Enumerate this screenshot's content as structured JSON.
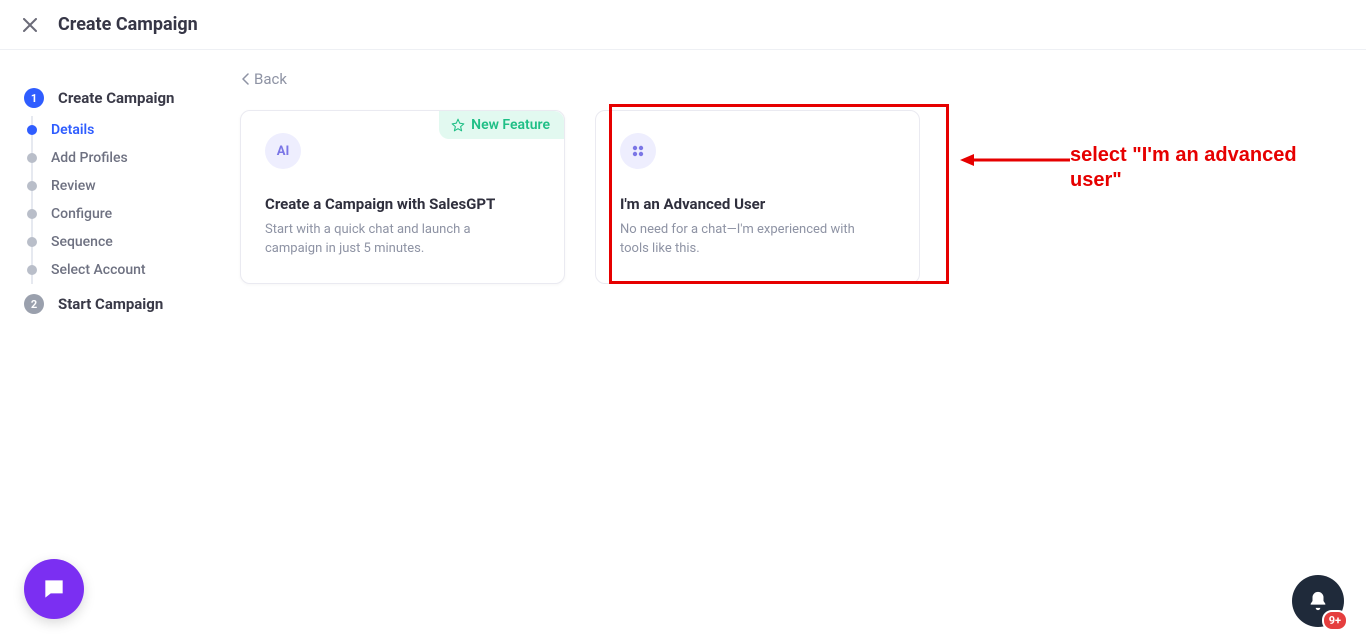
{
  "header": {
    "title": "Create Campaign"
  },
  "steps": [
    {
      "num": "1",
      "label": "Create Campaign",
      "active": true,
      "substeps": [
        {
          "label": "Details",
          "current": true
        },
        {
          "label": "Add Profiles",
          "current": false
        },
        {
          "label": "Review",
          "current": false
        },
        {
          "label": "Configure",
          "current": false
        },
        {
          "label": "Sequence",
          "current": false
        },
        {
          "label": "Select Account",
          "current": false
        }
      ]
    },
    {
      "num": "2",
      "label": "Start Campaign",
      "active": false,
      "substeps": []
    }
  ],
  "main": {
    "back": "Back",
    "cards": {
      "salesgpt": {
        "icon_label": "AI",
        "badge": "New Feature",
        "title": "Create a Campaign with SalesGPT",
        "desc": "Start with a quick chat and launch a campaign in just 5 minutes."
      },
      "advanced": {
        "title": "I'm an Advanced User",
        "desc": "No need for a chat—I'm experienced with tools like this."
      }
    }
  },
  "annotation": {
    "text": "select \"I'm an advanced user\""
  },
  "notifications": {
    "badge": "9+"
  }
}
